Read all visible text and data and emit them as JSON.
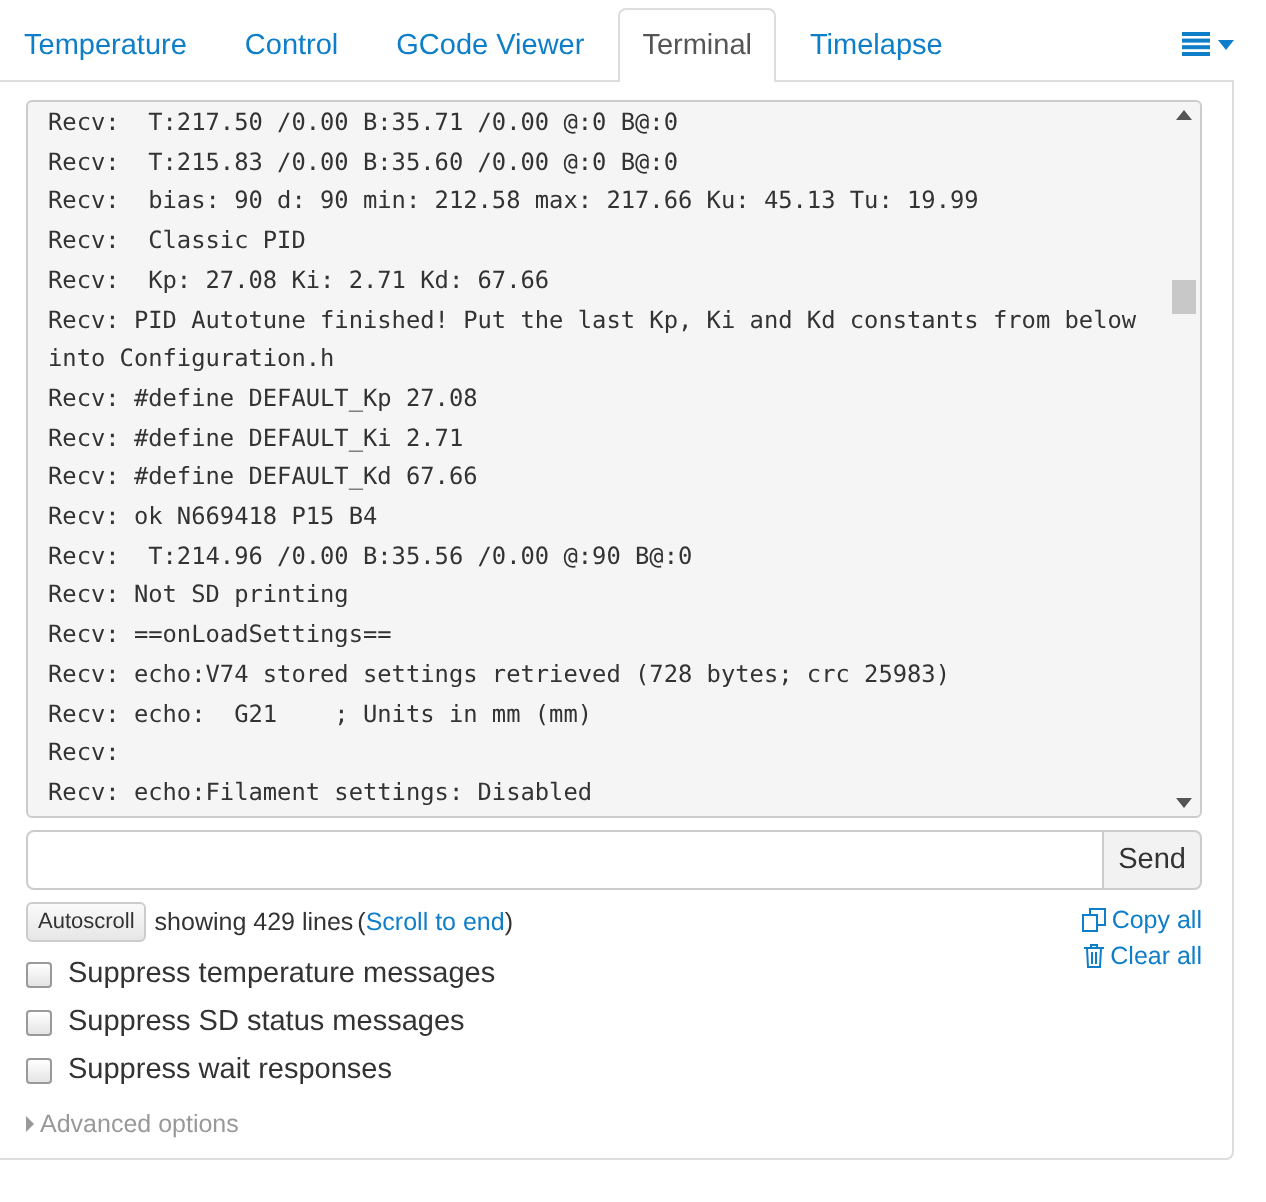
{
  "tabs": [
    {
      "label": "Temperature",
      "selected": false
    },
    {
      "label": "Control",
      "selected": false
    },
    {
      "label": "GCode Viewer",
      "selected": false
    },
    {
      "label": "Terminal",
      "selected": true
    },
    {
      "label": "Timelapse",
      "selected": false
    }
  ],
  "terminal": {
    "lines": [
      "Recv:  T:217.50 /0.00 B:35.71 /0.00 @:0 B@:0",
      "Recv:  T:215.83 /0.00 B:35.60 /0.00 @:0 B@:0",
      "Recv:  bias: 90 d: 90 min: 212.58 max: 217.66 Ku: 45.13 Tu: 19.99",
      "Recv:  Classic PID",
      "Recv:  Kp: 27.08 Ki: 2.71 Kd: 67.66",
      "Recv: PID Autotune finished! Put the last Kp, Ki and Kd constants from below into Configuration.h",
      "Recv: #define DEFAULT_Kp 27.08",
      "Recv: #define DEFAULT_Ki 2.71",
      "Recv: #define DEFAULT_Kd 67.66",
      "Recv: ok N669418 P15 B4",
      "Recv:  T:214.96 /0.00 B:35.56 /0.00 @:90 B@:0",
      "Recv: Not SD printing",
      "Recv: ==onLoadSettings==",
      "Recv: echo:V74 stored settings retrieved (728 bytes; crc 25983)",
      "Recv: echo:  G21    ; Units in mm (mm)",
      "Recv:",
      "Recv: echo:Filament settings: Disabled"
    ]
  },
  "send_button": "Send",
  "autoscroll_button": "Autoscroll",
  "status": {
    "text": "showing 429 lines",
    "open_paren": "(",
    "link": "Scroll to end",
    "close_paren": ")"
  },
  "copy_all": "Copy all",
  "clear_all": "Clear all",
  "options": [
    {
      "label": "Suppress temperature messages",
      "checked": false
    },
    {
      "label": "Suppress SD status messages",
      "checked": false
    },
    {
      "label": "Suppress wait responses",
      "checked": false
    }
  ],
  "advanced": {
    "label": "Advanced options"
  }
}
